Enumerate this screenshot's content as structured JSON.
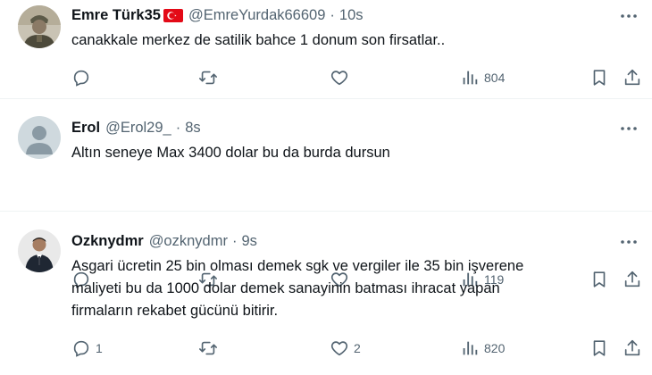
{
  "tweets": [
    {
      "name": "Emre Türk35",
      "has_flag": true,
      "handle": "@EmreYurdak66609",
      "separator": "·",
      "time": "10s",
      "text": "canakkale merkez de satilik bahce 1 donum son firsatlar..",
      "replies": "",
      "retweets": "",
      "likes": "",
      "views": "804"
    },
    {
      "name": "Erol",
      "has_flag": false,
      "handle": "@Erol29_",
      "separator": "·",
      "time": "8s",
      "text": "Altın seneye Max 3400 dolar bu da burda dursun",
      "replies": "",
      "retweets": "",
      "likes": "",
      "views": "119"
    },
    {
      "name": "Ozknydmr",
      "has_flag": false,
      "handle": "@ozknydmr",
      "separator": "·",
      "time": "9s",
      "text_lines": [
        "Asgari ücretin 25 bin olması demek sgk ve vergiler ile 35 bin işverene",
        "maliyeti bu da 1000 dolar demek sanayinin batması ihracat yapan",
        "firmaların rekabet gücünü bitirir."
      ],
      "replies": "1",
      "retweets": "",
      "likes": "2",
      "views": "820"
    }
  ],
  "icons": {
    "reply": "reply-icon",
    "retweet": "retweet-icon",
    "like": "heart-icon",
    "views": "views-chart-icon",
    "bookmark": "bookmark-icon",
    "share": "share-icon",
    "more": "more-dots-icon",
    "flag": "turkey-flag-icon"
  },
  "colors": {
    "text": "#0f1419",
    "muted": "#536471",
    "divider": "#eff3f4",
    "flag_red": "#e30a17"
  }
}
